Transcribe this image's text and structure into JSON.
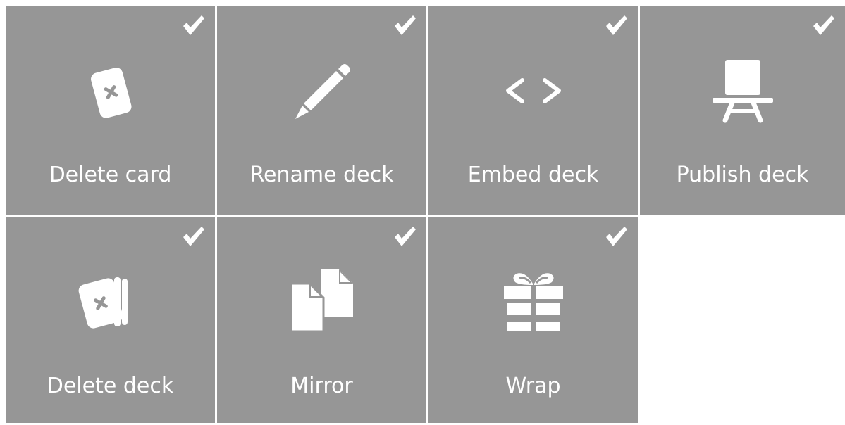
{
  "colors": {
    "tile_background": "#969696",
    "foreground": "#ffffff",
    "page_background": "#ffffff"
  },
  "tiles": [
    {
      "label": "Delete card",
      "icon": "card-x-icon",
      "selected": true
    },
    {
      "label": "Rename deck",
      "icon": "pencil-icon",
      "selected": true
    },
    {
      "label": "Embed deck",
      "icon": "code-brackets-icon",
      "selected": true
    },
    {
      "label": "Publish deck",
      "icon": "easel-icon",
      "selected": true
    },
    {
      "label": "Delete deck",
      "icon": "deck-x-icon",
      "selected": true
    },
    {
      "label": "Mirror",
      "icon": "duplicate-pages-icon",
      "selected": true
    },
    {
      "label": "Wrap",
      "icon": "gift-icon",
      "selected": true
    }
  ]
}
